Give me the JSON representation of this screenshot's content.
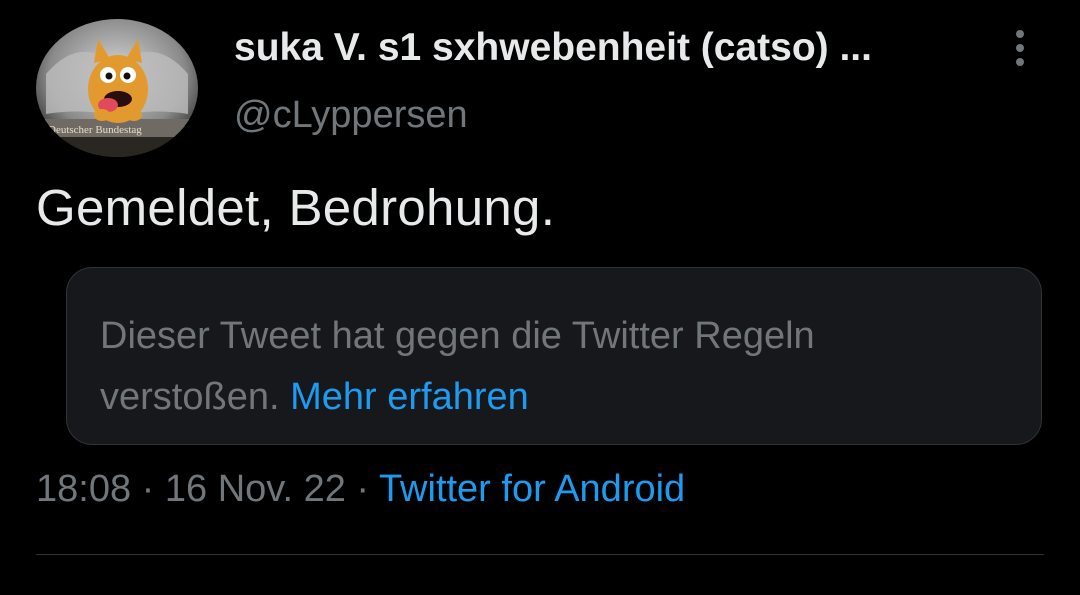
{
  "author": {
    "display_name": "suka V. s1 sxhwebenheit (catso) ...",
    "handle": "@cLyppersen",
    "avatar_caption": "Deutscher Bundestag"
  },
  "more_icon": "more-vertical-icon",
  "tweet": {
    "text": "Gemeldet, Bedrohung."
  },
  "notice": {
    "text": "Dieser Tweet hat gegen die Twitter Regeln verstoßen.",
    "link_label": "Mehr erfahren"
  },
  "meta": {
    "time": "18:08",
    "separator": "·",
    "date": "16 Nov. 22",
    "source": "Twitter for Android"
  },
  "colors": {
    "background": "#000000",
    "primary_text": "#e7e9ea",
    "secondary_text": "#71767b",
    "link": "#1d9bf0",
    "notice_bg": "#16181c",
    "border": "#2f3336"
  }
}
